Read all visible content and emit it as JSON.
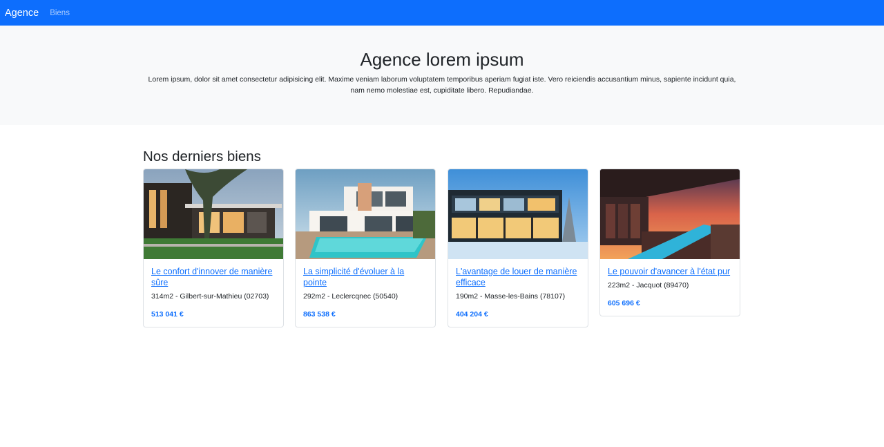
{
  "navbar": {
    "brand": "Agence",
    "links": [
      "Biens"
    ]
  },
  "hero": {
    "title": "Agence lorem ipsum",
    "text": "Lorem ipsum, dolor sit amet consectetur adipisicing elit. Maxime veniam laborum voluptatem temporibus aperiam fugiat iste. Vero reiciendis accusantium minus, sapiente incidunt quia, nam nemo molestiae est, cupiditate libero. Repudiandae."
  },
  "section": {
    "title": "Nos derniers biens"
  },
  "properties": [
    {
      "title": "Le confort d'innover de manière sûre",
      "meta": "314m2 - Gilbert-sur-Mathieu (02703)",
      "price": "513 041 €"
    },
    {
      "title": "La simplicité d'évoluer à la pointe",
      "meta": "292m2 - Leclercqnec (50540)",
      "price": "863 538 €"
    },
    {
      "title": "L'avantage de louer de manière efficace",
      "meta": "190m2 - Masse-les-Bains (78107)",
      "price": "404 204 €"
    },
    {
      "title": "Le pouvoir d'avancer à l'état pur",
      "meta": "223m2 - Jacquot (89470)",
      "price": "605 696 €"
    }
  ],
  "colors": {
    "primary": "#0d6efd",
    "hero_bg": "#f8f9fa",
    "text": "#212529"
  }
}
